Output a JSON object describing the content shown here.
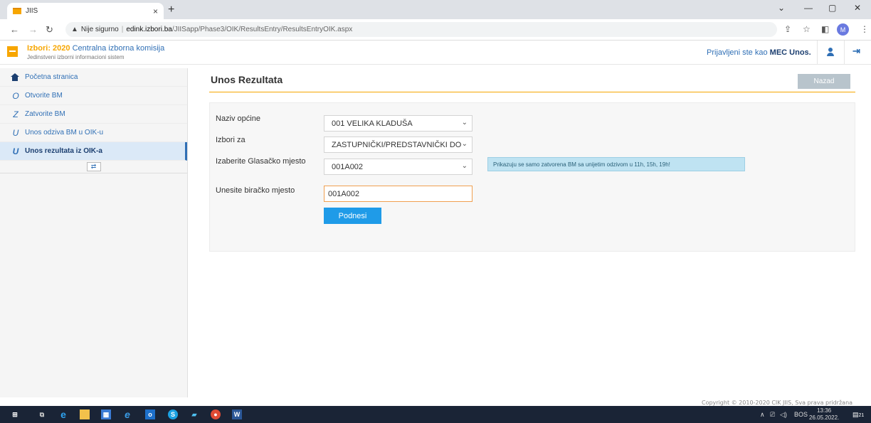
{
  "browser": {
    "tab_title": "JIIS",
    "tab_close": "×",
    "new_tab": "+",
    "insecure_label": "Nije sigurno",
    "url_host": "edink.izbori.ba",
    "url_path": "/JIISapp/Phase3/OIK/ResultsEntry/ResultsEntryOIK.aspx",
    "profile_initial": "M"
  },
  "header": {
    "brand_prefix": "Izbori: 2020",
    "brand_title": " Centralna izborna komisija",
    "brand_subtitle": "Jedinstveni izborni informacioni sistem",
    "logged_prefix": "Prijavljeni ste kao ",
    "logged_user": "MEC Unos."
  },
  "sidebar": {
    "items": [
      {
        "label": "Početna stranica",
        "icon": "home-icon"
      },
      {
        "label": "Otvorite BM",
        "glyph": "O"
      },
      {
        "label": "Zatvorite BM",
        "glyph": "Z"
      },
      {
        "label": "Unos odziva BM u OIK-u",
        "glyph": "U"
      },
      {
        "label": "Unos rezultata iz OIK-a",
        "glyph": "U"
      }
    ]
  },
  "main": {
    "title": "Unos Rezultata",
    "back_label": "Nazad",
    "form": {
      "opcina_label": "Naziv općine",
      "opcina_value": "001 VELIKA KLADUŠA",
      "izbori_label": "Izbori za",
      "izbori_value": "ZASTUPNIČKI/PREDSTAVNIČKI DO",
      "gm_label": "Izaberite Glasačko mjesto",
      "gm_value": "001A002",
      "bm_label": "Unesite biračko mjesto",
      "bm_value": "001A002",
      "submit_label": "Podnesi",
      "info_note": "Prikazuju se samo zatvorena BM sa unijetim odzivom u 11h, 15h, 19h!"
    }
  },
  "footer": {
    "copyright": "Copyright © 2010-2020 CIK JIIS, Sva prava pridržana"
  },
  "taskbar": {
    "lang": "BOS",
    "time": "13:36",
    "date": "26.05.2022.",
    "notif_count": "21"
  },
  "colors": {
    "accent_orange": "#f7a600",
    "brand_blue": "#2f6fb5",
    "submit_blue": "#1f9be8"
  }
}
